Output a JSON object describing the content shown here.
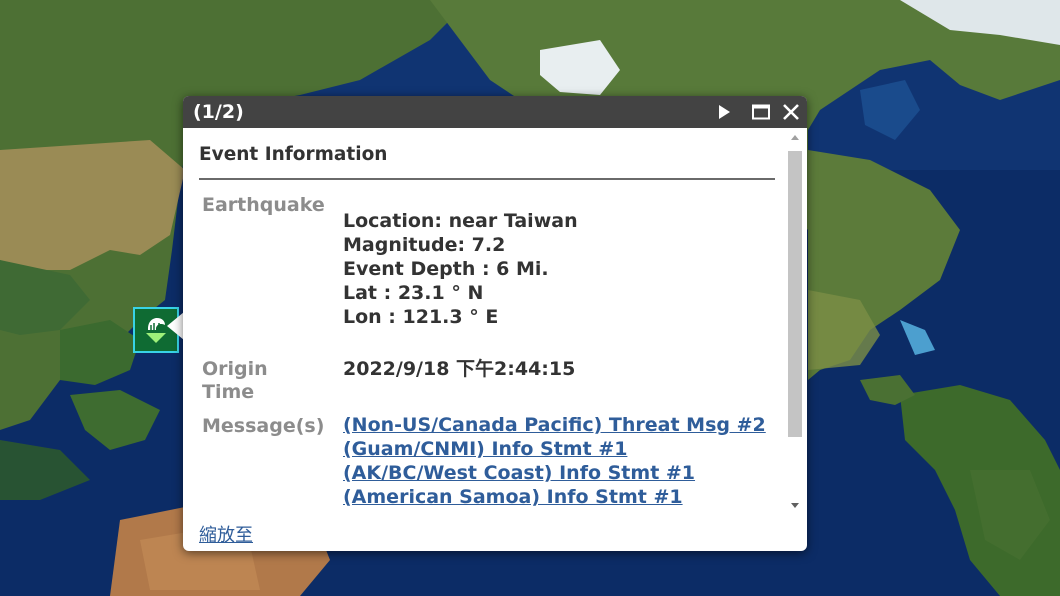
{
  "popup": {
    "count": "(1/2)",
    "heading": "Event Information",
    "fields": {
      "earthquake": {
        "label": "Earthquake",
        "lines": [
          "Location: near Taiwan",
          "Magnitude: 7.2",
          "Event Depth : 6 Mi.",
          "Lat : 23.1 ° N",
          "Lon : 121.3 ° E"
        ]
      },
      "origin": {
        "label_line1": "Origin",
        "label_line2": "Time",
        "value": "2022/9/18 下午2:44:15"
      },
      "messages": {
        "label": "Message(s)",
        "links": [
          "(Non-US/Canada Pacific) Threat Msg #2",
          "(Guam/CNMI) Info Stmt #1",
          "(AK/BC/West Coast) Info Stmt #1",
          "(American Samoa) Info Stmt #1"
        ]
      }
    },
    "zoom_link": "縮放至",
    "icons": {
      "next": "play-triangle-icon",
      "maximize": "maximize-window-icon",
      "close": "close-x-icon"
    }
  },
  "map": {
    "marker_icon": "tsunami-warning-icon",
    "colors": {
      "ocean": "#0c2c66",
      "land": "#4d7034",
      "marker_border": "#38d3e6",
      "title_bar": "#434343",
      "link": "#2f5d9a"
    }
  }
}
